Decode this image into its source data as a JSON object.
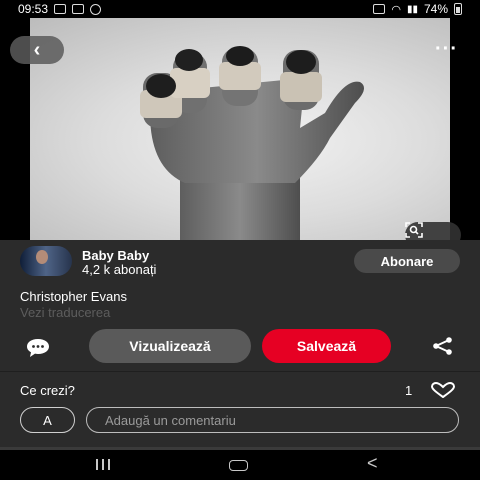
{
  "status_bar": {
    "time": "09:53",
    "battery": "74%"
  },
  "pin": {
    "image_alt": "Black and white photograph of a raised hand with bandaged fingertips",
    "channel": {
      "name": "Baby Baby",
      "subscribers": "4,2 k abonați",
      "subscribe_label": "Abonare"
    },
    "title": "Christopher Evans",
    "translate_label": "Vezi traducerea",
    "actions": {
      "view_label": "Vizualizează",
      "save_label": "Salvează"
    },
    "comments": {
      "prompt": "Ce crezi?",
      "likes": "1",
      "user_initial": "A",
      "placeholder": "Adaugă un comentariu"
    }
  },
  "colors": {
    "accent_red": "#e60023",
    "panel_bg": "#2b2b2b",
    "secondary_button": "#5a5a5a"
  },
  "icons": {
    "back": "back-arrow-icon",
    "more": "more-options-icon",
    "lens": "visual-search-icon",
    "comment": "comment-bubble-icon",
    "share": "share-icon",
    "heart": "heart-icon"
  }
}
